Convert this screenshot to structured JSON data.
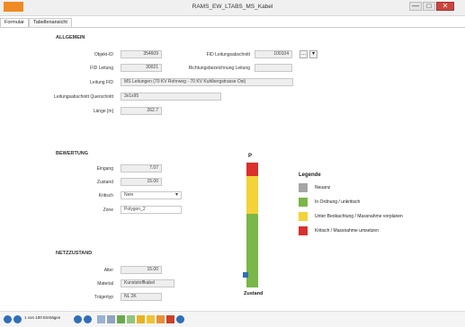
{
  "window": {
    "title": "RAMS_EW_LTABS_MS_Kabel",
    "controls": [
      "—",
      "□",
      "✕"
    ]
  },
  "tabs": [
    "Formular",
    "Tabellenansicht"
  ],
  "allgemein": {
    "heading": "ALLGEMEIN",
    "objekt_id": {
      "label": "Objekt-ID",
      "value": "354609"
    },
    "fid_lab": {
      "label": "FID Leitungsabschnitt",
      "value": "100104"
    },
    "fid_leitung": {
      "label": "FID Leitung",
      "value": "30021"
    },
    "richtungsbez": {
      "label": "Richtungsbezeichnung Leitung",
      "value": ""
    },
    "leitung_fid": {
      "label": "Leitung FID",
      "value": "MS Leitungen (70 KV Rohrweg - 70 KV Kuhlbergstrasse Ost)"
    },
    "querschnitt": {
      "label": "Leitungsabschnitt Querschnitt",
      "value": "3x1x95"
    },
    "laenge": {
      "label": "Länge [m]",
      "value": "262.7"
    },
    "mini_buttons": [
      "…",
      "▾"
    ]
  },
  "bewertung": {
    "heading": "BEWERTUNG",
    "eingang": {
      "label": "Eingang",
      "value": "7.07"
    },
    "zustand": {
      "label": "Zustand",
      "value": "15.00"
    },
    "kritisch": {
      "label": "Kritisch",
      "value": "Nein"
    },
    "zone": {
      "label": "Zone",
      "value": "Polygon_2"
    }
  },
  "netzzustand": {
    "heading": "NETZZUSTAND",
    "alter": {
      "label": "Alter",
      "value": "15.00"
    },
    "material": {
      "label": "Material",
      "value": "Kunststoffkabel"
    },
    "typ": {
      "label": "Trägertyp",
      "value": "NL 2K"
    }
  },
  "gauge": {
    "label_top": "P",
    "label_bottom": "Zustand",
    "marker_level": 0.1
  },
  "legend": {
    "title": "Legende",
    "items": [
      {
        "label": "Neuanz",
        "color": "#a6a6a6"
      },
      {
        "label": "In Ordnung / unkritisch",
        "color": "#7ab648"
      },
      {
        "label": "Unter Beobachtung / Massnahme vorplanen",
        "color": "#f3d23a"
      },
      {
        "label": "Kritisch / Massnahme umsetzen",
        "color": "#d9302c"
      }
    ]
  },
  "colors": {
    "red": "#d9302c",
    "yellow": "#f3d23a",
    "green": "#7ab648",
    "marker": "#2f6fb7"
  },
  "statusbar": {
    "record_text": "1 von 100 Einträgen"
  }
}
